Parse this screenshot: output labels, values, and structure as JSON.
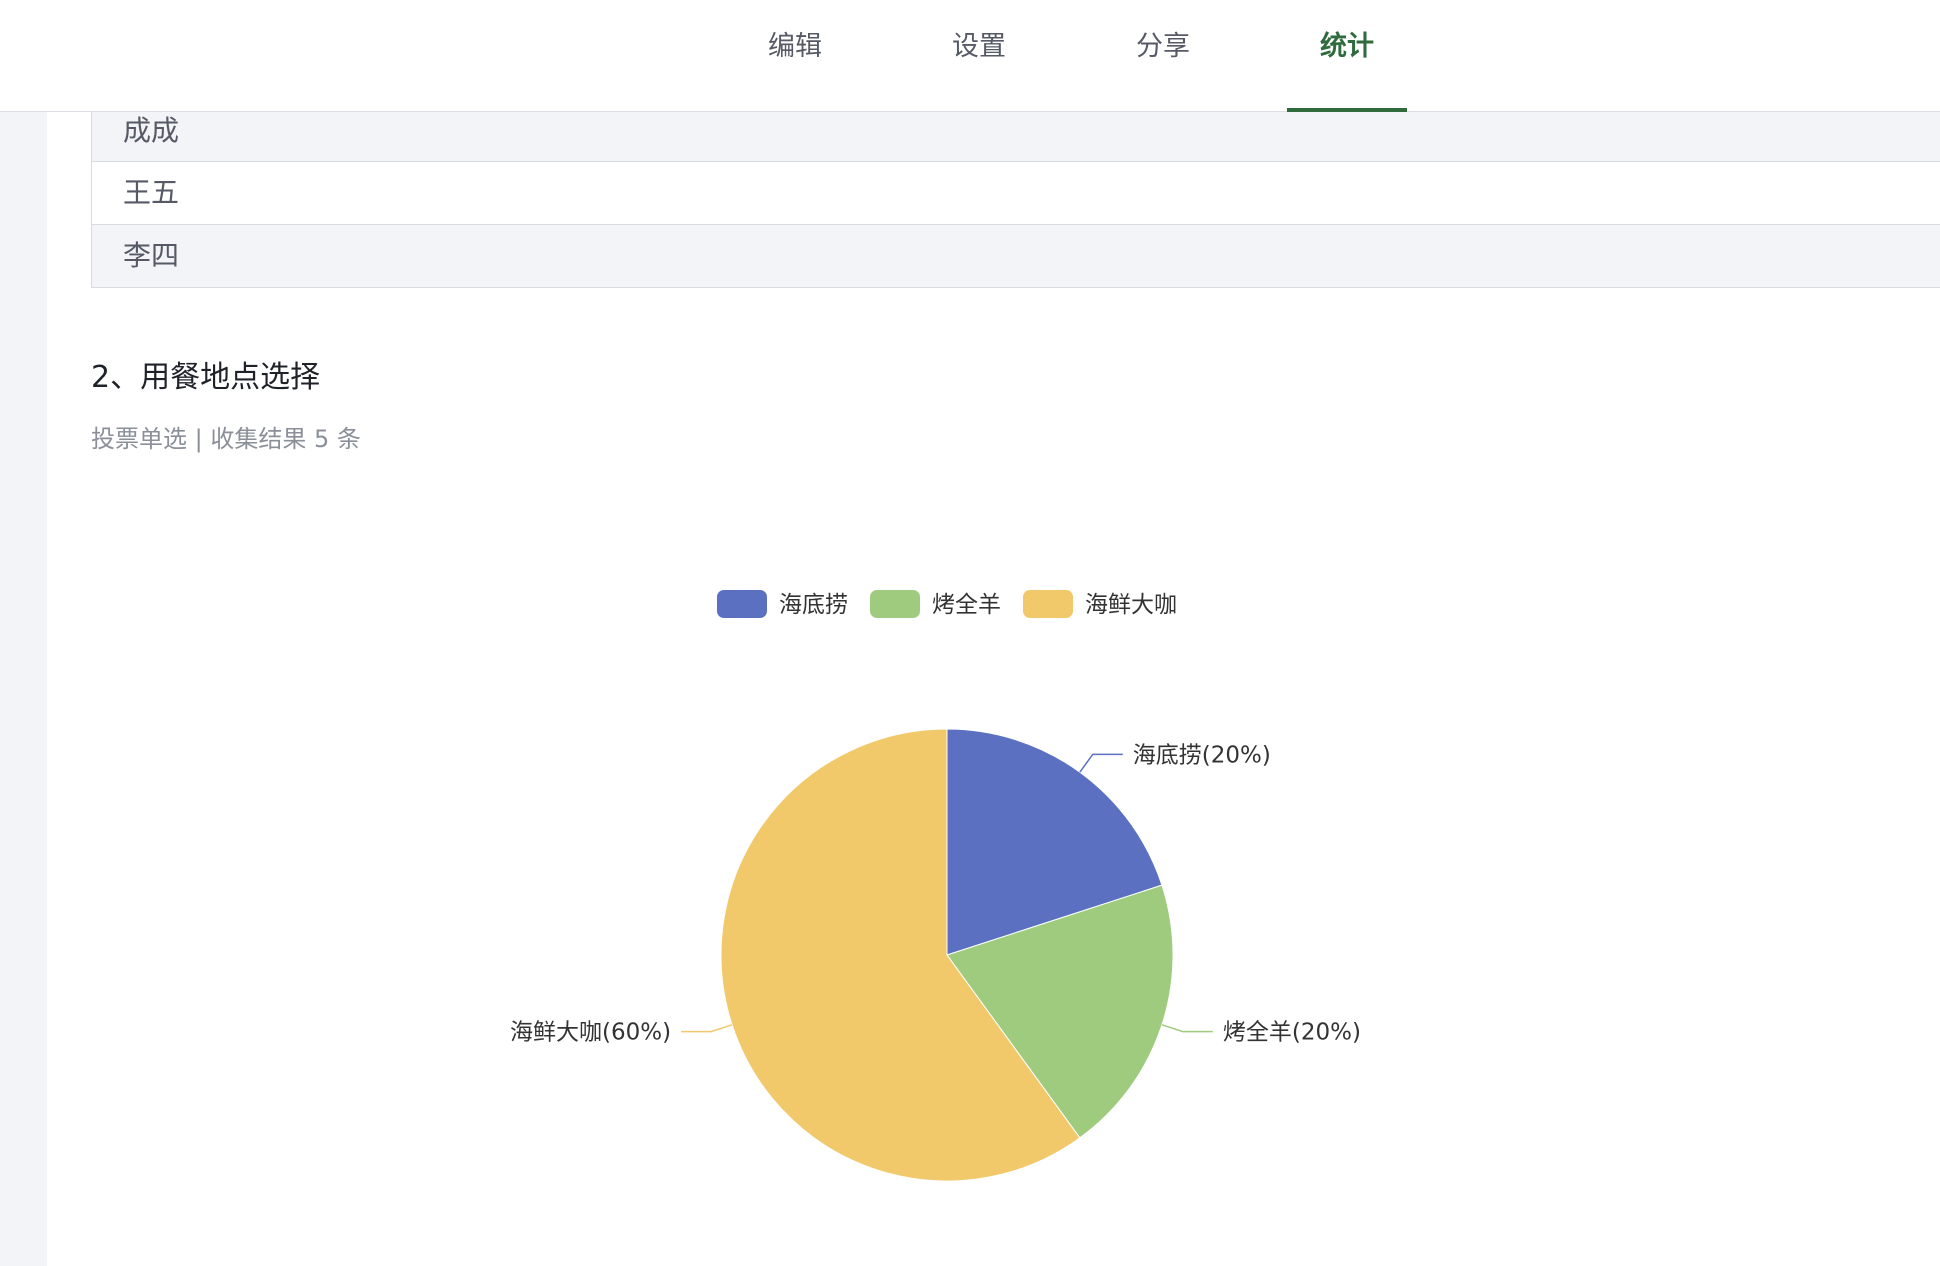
{
  "tabs": [
    {
      "label": "编辑",
      "active": false
    },
    {
      "label": "设置",
      "active": false
    },
    {
      "label": "分享",
      "active": false
    },
    {
      "label": "统计",
      "active": true
    }
  ],
  "answers": [
    "成成",
    "王五",
    "李四"
  ],
  "question": {
    "title": "2、用餐地点选择",
    "meta": "投票单选 | 收集结果 5 条"
  },
  "colors": {
    "accent": "#2f6b3d",
    "slice_1": "#5b70c0",
    "slice_2": "#9fcb7e",
    "slice_3": "#f1c96a"
  },
  "chart_data": {
    "type": "pie",
    "categories": [
      "海底捞",
      "烤全羊",
      "海鲜大咖"
    ],
    "values": [
      20,
      20,
      60
    ],
    "unit": "%",
    "slice_labels": [
      "海底捞(20%)",
      "烤全羊(20%)",
      "海鲜大咖(60%)"
    ],
    "legend": "top",
    "colors": [
      "#5b70c0",
      "#9fcb7e",
      "#f1c96a"
    ]
  }
}
